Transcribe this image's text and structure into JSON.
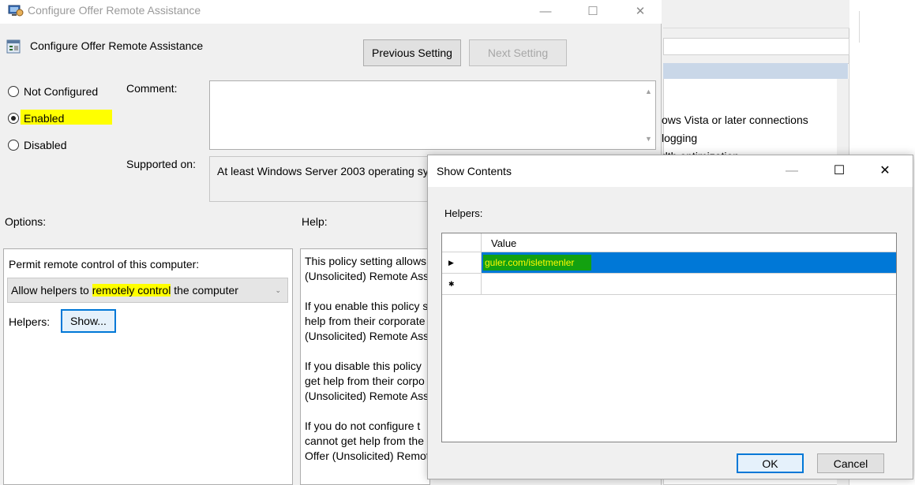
{
  "background_window": {
    "items": [
      "ows Vista or later connections",
      "logging",
      "dth optimization"
    ]
  },
  "main_window": {
    "title": "Configure Offer Remote Assistance",
    "caption": {
      "minimize": "—",
      "maximize": "☐",
      "close": "✕"
    },
    "policy_name": "Configure Offer Remote Assistance",
    "previous_setting": "Previous Setting",
    "next_setting": "Next Setting",
    "state": {
      "not_configured": "Not Configured",
      "enabled": "Enabled",
      "disabled": "Disabled",
      "selected": "Enabled"
    },
    "comment_label": "Comment:",
    "supported_label": "Supported on:",
    "supported_value": "At least Windows Server 2003 operating sy",
    "options_label": "Options:",
    "help_label": "Help:",
    "options": {
      "permit_label": "Permit remote control of this computer:",
      "combo_prefix": "Allow helpers to ",
      "combo_highlight": "remotely control",
      "combo_suffix": " the computer",
      "helpers_label": "Helpers:",
      "show_button": "Show..."
    },
    "help_text": "This policy setting allows\n(Unsolicited) Remote Assi\n\nIf you enable this policy s\nhelp from their corporate\n(Unsolicited) Remote Assi\n\nIf you disable this policy\nget help from their corpo\n(Unsolicited) Remote Assi\n\nIf you do not configure t\ncannot get help from the\nOffer (Unsolicited) Remot"
  },
  "dialog": {
    "title": "Show Contents",
    "caption": {
      "minimize": "—",
      "maximize": "☐",
      "close": "✕"
    },
    "helpers_label": "Helpers:",
    "column_header": "Value",
    "rows": [
      {
        "marker": "▶",
        "value": "guler.com/isletmenler",
        "selected": true
      },
      {
        "marker": "✱",
        "value": ""
      }
    ],
    "ok": "OK",
    "cancel": "Cancel"
  },
  "colors": {
    "highlight_yellow": "#ffff00",
    "selection_blue": "#0078d7",
    "value_highlight_green": "#13a110",
    "value_text_yellow": "#fffa00"
  }
}
